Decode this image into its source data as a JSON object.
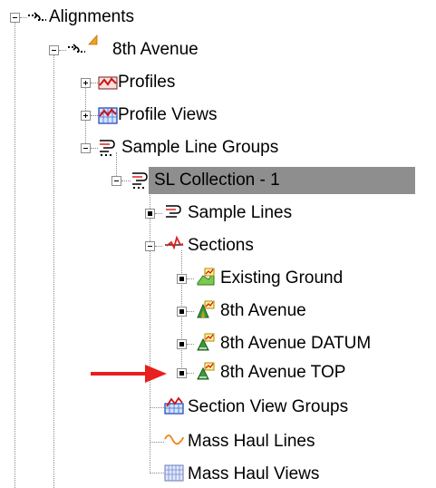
{
  "tree": {
    "alignments_label": "Alignments",
    "alignment_name": "8th Avenue",
    "profiles_label": "Profiles",
    "profile_views_label": "Profile Views",
    "sample_line_groups_label": "Sample Line Groups",
    "sl_collection_label": "SL Collection - 1",
    "sample_lines_label": "Sample Lines",
    "sections_label": "Sections",
    "sections": [
      "Existing Ground",
      "8th Avenue",
      "8th Avenue DATUM",
      "8th Avenue TOP"
    ],
    "section_view_groups_label": "Section View Groups",
    "mass_haul_lines_label": "Mass Haul Lines",
    "mass_haul_views_label": "Mass Haul Views"
  },
  "annotation": {
    "arrow_color": "#e8201e",
    "pointing_to": "8th Avenue TOP"
  },
  "colors": {
    "selection_background": "#8e8e8e",
    "tree_lines": "#8a8a8a"
  }
}
